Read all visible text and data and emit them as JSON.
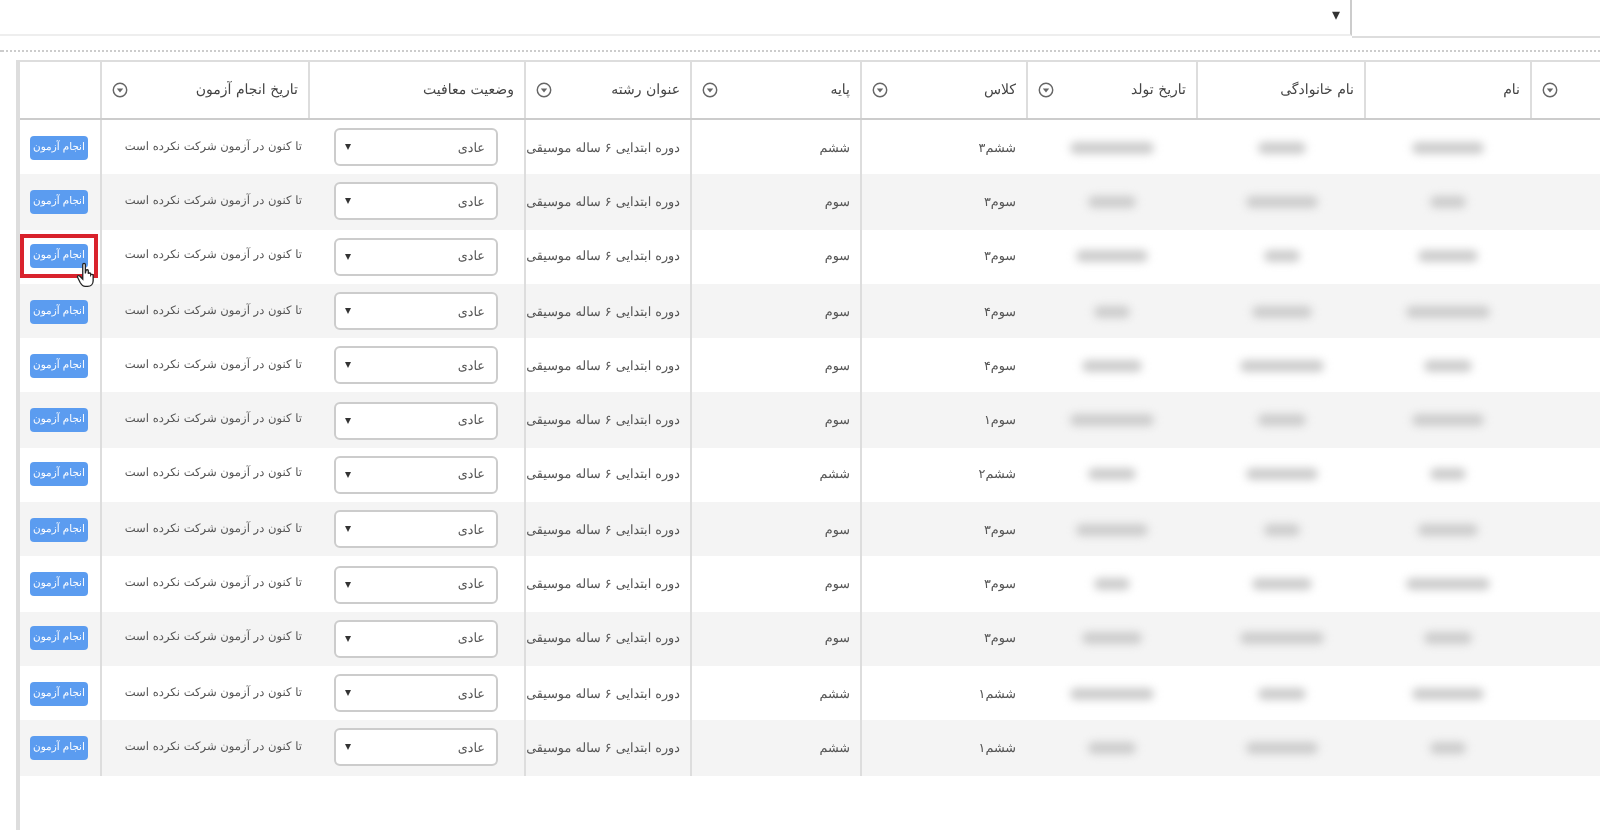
{
  "toolbar": {
    "dropdown_arrow": "▾"
  },
  "table": {
    "columns": [
      {
        "kind": "filter",
        "filter": true
      },
      {
        "kind": "blur",
        "label": "نام",
        "filter": false
      },
      {
        "kind": "blur",
        "label": "نام خانوادگی",
        "filter": false
      },
      {
        "kind": "blur",
        "label": "تاریخ تولد",
        "filter": true
      },
      {
        "kind": "class",
        "label": "کلاس",
        "filter": true
      },
      {
        "kind": "grade",
        "label": "پایه",
        "filter": true
      },
      {
        "kind": "major",
        "label": "عنوان رشته",
        "filter": true
      },
      {
        "kind": "status",
        "label": "وضعیت معافیت",
        "filter": false
      },
      {
        "kind": "date",
        "label": "تاریخ انجام آزمون",
        "filter": true
      },
      {
        "kind": "action",
        "filter": false
      }
    ],
    "rows": [
      {
        "grade": "ششم",
        "class": "ششم۳",
        "major": "دوره ابتدایی ۶ ساله موسیقی",
        "status": "عادی",
        "date": "تا کنون در آزمون شرکت نکرده است",
        "button": "انجام آزمون",
        "highlighted": false
      },
      {
        "grade": "سوم",
        "class": "سوم۳",
        "major": "دوره ابتدایی ۶ ساله موسیقی",
        "status": "عادی",
        "date": "تا کنون در آزمون شرکت نکرده است",
        "button": "انجام آزمون",
        "highlighted": false
      },
      {
        "grade": "سوم",
        "class": "سوم۳",
        "major": "دوره ابتدایی ۶ ساله موسیقی",
        "status": "عادی",
        "date": "تا کنون در آزمون شرکت نکرده است",
        "button": "انجام آزمون",
        "highlighted": true
      },
      {
        "grade": "سوم",
        "class": "سوم۴",
        "major": "دوره ابتدایی ۶ ساله موسیقی",
        "status": "عادی",
        "date": "تا کنون در آزمون شرکت نکرده است",
        "button": "انجام آزمون",
        "highlighted": false
      },
      {
        "grade": "سوم",
        "class": "سوم۴",
        "major": "دوره ابتدایی ۶ ساله موسیقی",
        "status": "عادی",
        "date": "تا کنون در آزمون شرکت نکرده است",
        "button": "انجام آزمون",
        "highlighted": false
      },
      {
        "grade": "سوم",
        "class": "سوم۱",
        "major": "دوره ابتدایی ۶ ساله موسیقی",
        "status": "عادی",
        "date": "تا کنون در آزمون شرکت نکرده است",
        "button": "انجام آزمون",
        "highlighted": false
      },
      {
        "grade": "ششم",
        "class": "ششم۲",
        "major": "دوره ابتدایی ۶ ساله موسیقی",
        "status": "عادی",
        "date": "تا کنون در آزمون شرکت نکرده است",
        "button": "انجام آزمون",
        "highlighted": false
      },
      {
        "grade": "سوم",
        "class": "سوم۳",
        "major": "دوره ابتدایی ۶ ساله موسیقی",
        "status": "عادی",
        "date": "تا کنون در آزمون شرکت نکرده است",
        "button": "انجام آزمون",
        "highlighted": false
      },
      {
        "grade": "سوم",
        "class": "سوم۳",
        "major": "دوره ابتدایی ۶ ساله موسیقی",
        "status": "عادی",
        "date": "تا کنون در آزمون شرکت نکرده است",
        "button": "انجام آزمون",
        "highlighted": false
      },
      {
        "grade": "سوم",
        "class": "سوم۳",
        "major": "دوره ابتدایی ۶ ساله موسیقی",
        "status": "عادی",
        "date": "تا کنون در آزمون شرکت نکرده است",
        "button": "انجام آزمون",
        "highlighted": false
      },
      {
        "grade": "ششم",
        "class": "ششم۱",
        "major": "دوره ابتدایی ۶ ساله موسیقی",
        "status": "عادی",
        "date": "تا کنون در آزمون شرکت نکرده است",
        "button": "انجام آزمون",
        "highlighted": false
      },
      {
        "grade": "ششم",
        "class": "ششم۱",
        "major": "دوره ابتدایی ۶ ساله موسیقی",
        "status": "عادی",
        "date": "تا کنون در آزمون شرکت نکرده است",
        "button": "انجام آزمون",
        "highlighted": false
      }
    ]
  }
}
